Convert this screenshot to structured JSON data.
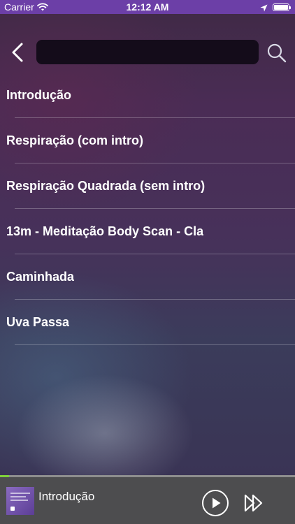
{
  "status_bar": {
    "carrier": "Carrier",
    "time": "12:12 AM"
  },
  "header": {
    "search": {
      "value": "",
      "placeholder": ""
    }
  },
  "tracks": [
    {
      "title": "Introdução"
    },
    {
      "title": "Respiração (com intro)"
    },
    {
      "title": "Respiração Quadrada (sem intro)"
    },
    {
      "title": "13m - Meditação Body Scan - Cla"
    },
    {
      "title": "Caminhada"
    },
    {
      "title": "Uva Passa"
    }
  ],
  "player": {
    "now_playing_title": "Introdução",
    "progress": 0.03
  },
  "colors": {
    "status_bar_bg": "#6c3fa7",
    "player_bg": "#4d4d4f",
    "progress_accent": "#7fd13b",
    "search_bg": "#140c1a"
  },
  "icons": [
    "wifi-icon",
    "location-arrow-icon",
    "battery-icon",
    "back-chevron-icon",
    "search-icon",
    "play-icon",
    "fast-forward-icon"
  ]
}
